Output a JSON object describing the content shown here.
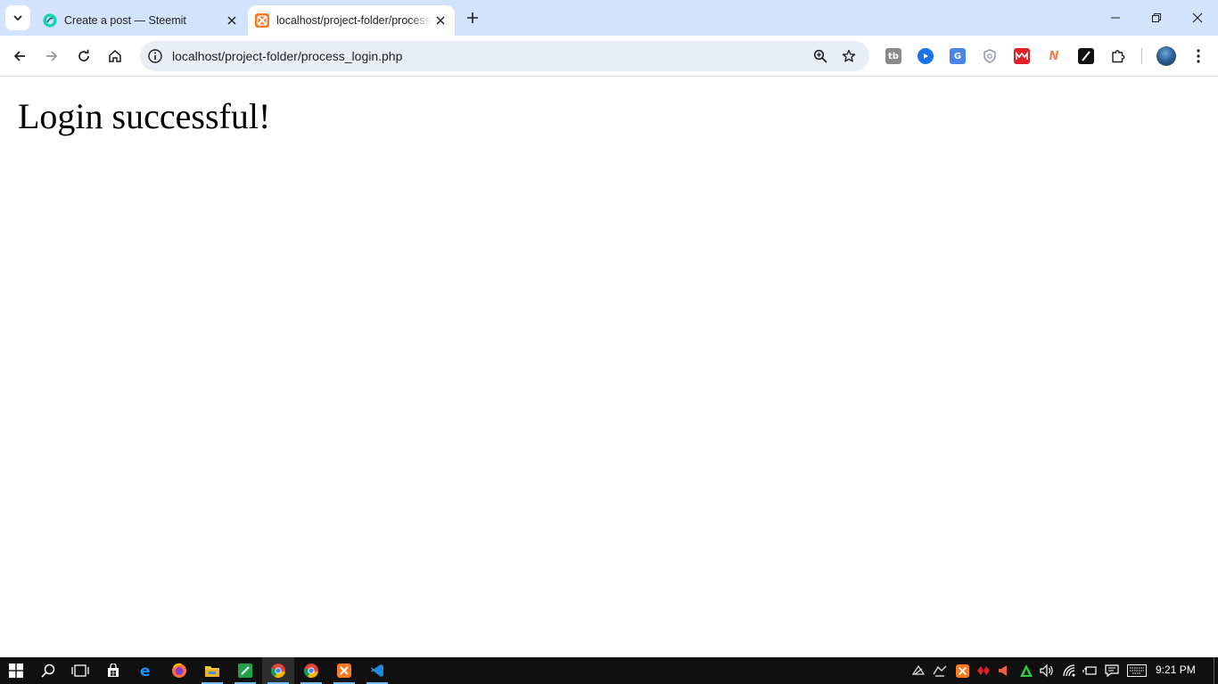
{
  "browser": {
    "tabs": [
      {
        "title": "Create a post — Steemit",
        "active": false,
        "favicon": "steemit-icon"
      },
      {
        "title": "localhost/project-folder/process_login.php",
        "active": true,
        "favicon": "xampp-icon"
      }
    ],
    "address_bar": {
      "url": "localhost/project-folder/process_login.php"
    },
    "extensions": [
      "ext-tb-icon",
      "ext-play-icon",
      "ext-translate-icon",
      "ext-shield-icon",
      "ext-mega-icon",
      "ext-n-icon",
      "ext-slash-icon",
      "extensions-puzzle-icon"
    ],
    "colors": {
      "tabstrip": "#d3e3fd",
      "omnibox": "#e9eef6"
    }
  },
  "page": {
    "heading": "Login successful!"
  },
  "taskbar": {
    "apps": [
      "start-icon",
      "search-icon",
      "task-view-icon",
      "store-icon",
      "edge-icon",
      "firefox-icon",
      "file-explorer-icon",
      "green-app-icon",
      "chrome-icon",
      "chrome-profile-icon",
      "xampp-icon",
      "vscode-icon"
    ],
    "clock": "9:21 PM"
  }
}
